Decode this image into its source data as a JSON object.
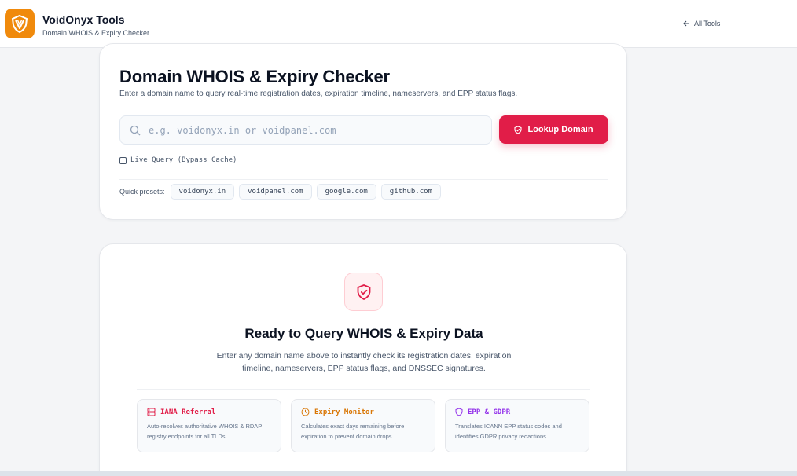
{
  "header": {
    "app_title": "VoidOnyx Tools",
    "app_subtitle": "Domain WHOIS & Expiry Checker",
    "back_label": "All Tools",
    "logo_color": "#f08a0c"
  },
  "search": {
    "heading": "Domain WHOIS & Expiry Checker",
    "subheading": "Enter a domain name to query real-time registration dates, expiration timeline, nameservers, and EPP status flags.",
    "placeholder": "e.g. voidonyx.in or voidpanel.com",
    "value": "",
    "button_label": "Lookup Domain",
    "live_query_label": "Live Query (Bypass Cache)",
    "live_query_checked": false,
    "presets_label": "Quick presets:",
    "presets": [
      "voidonyx.in",
      "voidpanel.com",
      "google.com",
      "github.com"
    ],
    "accent": "#e11d48"
  },
  "ready": {
    "title": "Ready to Query WHOIS & Expiry Data",
    "description": "Enter any domain name above to instantly check its registration dates, expiration timeline, nameservers, EPP status flags, and DNSSEC signatures.",
    "features": [
      {
        "title": "IANA Referral",
        "description": "Auto-resolves authoritative WHOIS & RDAP registry endpoints for all TLDs.",
        "icon": "server-icon",
        "color": "#e11d48"
      },
      {
        "title": "Expiry Monitor",
        "description": "Calculates exact days remaining before expiration to prevent domain drops.",
        "icon": "clock-icon",
        "color": "#d97706"
      },
      {
        "title": "EPP & GDPR",
        "description": "Translates ICANN EPP status codes and identifies GDPR privacy redactions.",
        "icon": "shield-icon",
        "color": "#9333ea"
      }
    ]
  }
}
